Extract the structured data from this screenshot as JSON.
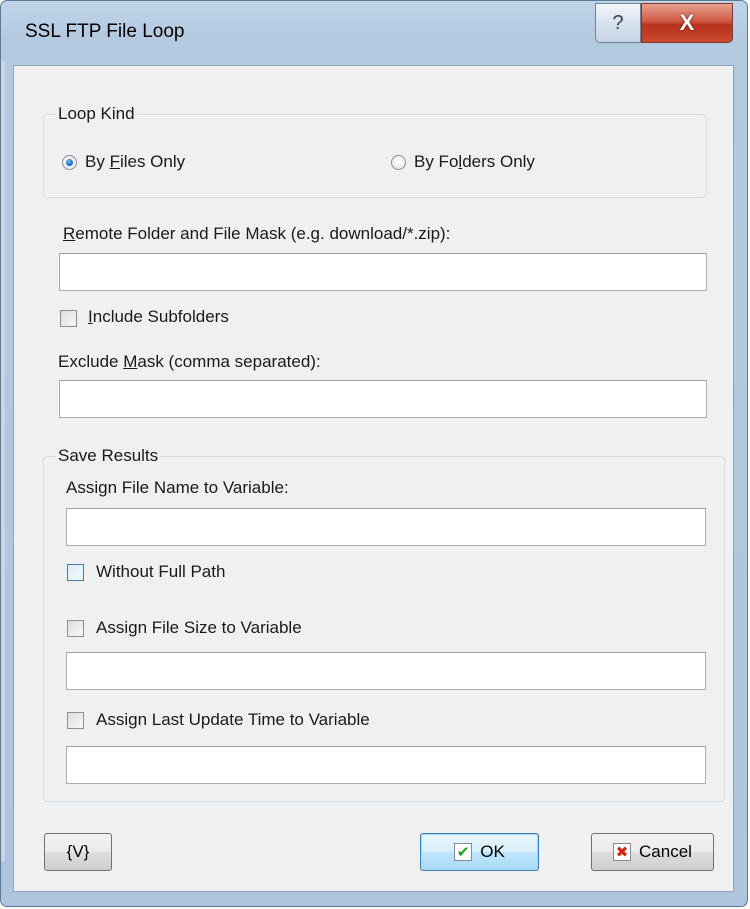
{
  "window": {
    "title": "SSL FTP File Loop",
    "help_glyph": "?",
    "close_glyph": "X"
  },
  "loop_kind": {
    "label": "Loop Kind",
    "options": [
      {
        "pre": "By ",
        "accel": "F",
        "post": "iles Only",
        "checked": true
      },
      {
        "pre": "By Fo",
        "accel": "l",
        "post": "ders Only",
        "checked": false
      }
    ]
  },
  "remote": {
    "accel": "R",
    "label_rest": "emote Folder and File Mask (e.g. download/*.zip):",
    "value": ""
  },
  "include_subfolders": {
    "accel": "I",
    "label_rest": "nclude Subfolders",
    "checked": false
  },
  "exclude": {
    "pre": "Exclude ",
    "accel": "M",
    "post": "ask (comma separated):",
    "value": ""
  },
  "save_results": {
    "label": "Save Results",
    "file_name_label": "Assign File Name to Variable:",
    "file_name_value": "",
    "without_full_path": "Without Full Path",
    "file_size_label": "Assign File Size to Variable",
    "file_size_value": "",
    "last_update_label": "Assign Last Update Time to Variable",
    "last_update_value": ""
  },
  "buttons": {
    "variables": "{V}",
    "ok": "OK",
    "ok_icon": "✔",
    "cancel": "Cancel",
    "cancel_icon": "✖"
  },
  "colors": {
    "accent": "#3c7fb1",
    "close_red": "#c94a2f"
  }
}
